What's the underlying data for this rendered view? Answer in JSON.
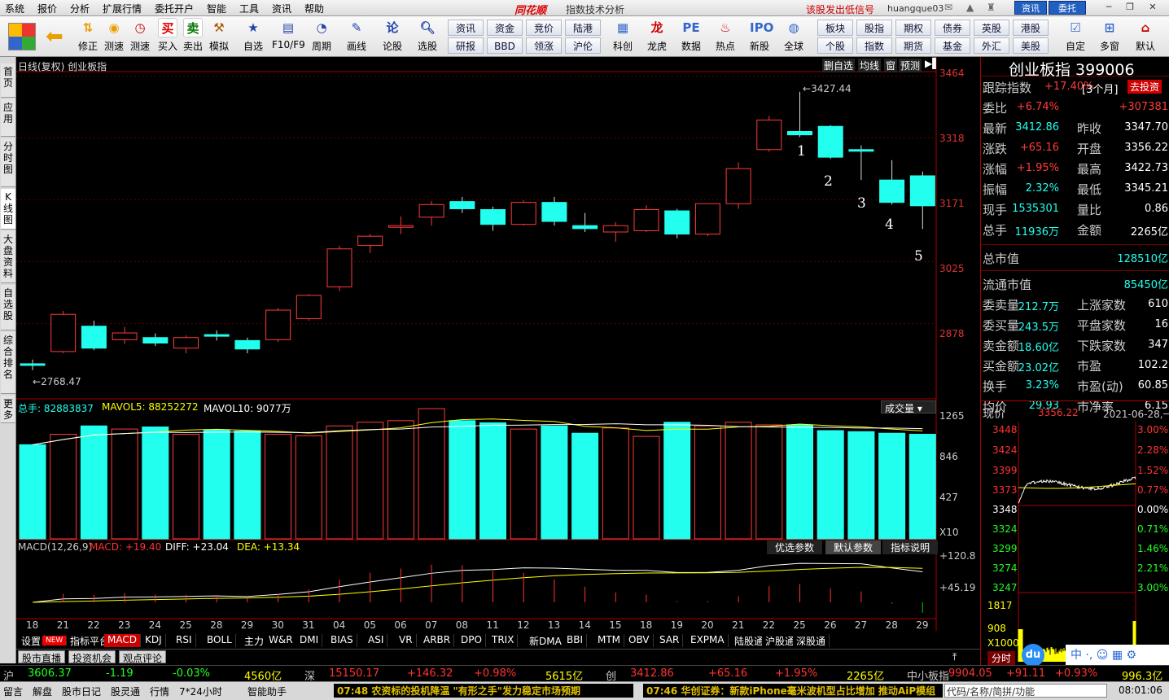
{
  "menu": {
    "items": [
      "系统",
      "报价",
      "分析",
      "扩展行情",
      "委托开户",
      "智能",
      "工具",
      "资讯",
      "帮助"
    ],
    "logo": "同花顺",
    "app_title": "指数技术分析",
    "signal": "该股发出低信号",
    "user": "huangque03",
    "btn_news": "资讯",
    "btn_trade": "委托"
  },
  "toolbar": {
    "buttons": [
      "修正",
      "测速",
      "买入",
      "卖出",
      "模拟",
      "自选",
      "F10/F9",
      "周期",
      "画线",
      "论股",
      "选股",
      "科创",
      "龙虎",
      "数据",
      "热点",
      "新股",
      "全球",
      "自定",
      "多窗",
      "默认"
    ],
    "grid": [
      [
        "资讯",
        "资金",
        "竞价",
        "陆港"
      ],
      [
        "研报",
        "BBD",
        "领涨",
        "沪伦"
      ],
      [
        "板块",
        "股指",
        "期权",
        "债券",
        "英股",
        "港股"
      ],
      [
        "个股",
        "指数",
        "期货",
        "基金",
        "外汇",
        "美股"
      ]
    ]
  },
  "lefttabs": [
    "首页",
    "应用",
    "分时图",
    "K线图",
    "大盘资料",
    "自选股",
    "综合排名",
    "更多"
  ],
  "chart": {
    "header_left": "日线(复权) 创业板指",
    "header_right": [
      "删自选",
      "均线",
      "窗",
      "预测"
    ],
    "price_ticks": [
      "3464",
      "3318",
      "3171",
      "3025",
      "2878"
    ],
    "high_label": "3427.44",
    "low_label": "2768.47",
    "markers": [
      "1",
      "2",
      "3",
      "4",
      "5"
    ],
    "vol_header": {
      "t1": "总手: 82883837",
      "t2": "MAVOL5: 88252272",
      "t3": "MAVOL10: 9077万"
    },
    "vol_select": "成交量",
    "vol_ticks": [
      "1265",
      "846",
      "427"
    ],
    "vol_unit": "X10",
    "macd_header": {
      "t1": "MACD(12,26,9)",
      "t2": "MACD: +19.40",
      "t3": "DIFF: +23.04",
      "t4": "DEA: +13.34"
    },
    "macd_btns": [
      "优选参数",
      "默认参数",
      "指标说明"
    ],
    "macd_ticks": [
      "+120.8",
      "+45.19"
    ],
    "x_labels": [
      "18",
      "21",
      "22",
      "23",
      "24",
      "25",
      "28",
      "29",
      "30",
      "31",
      "04",
      "05",
      "06",
      "07",
      "08",
      "11",
      "12",
      "13",
      "14",
      "15",
      "18",
      "19",
      "20",
      "21",
      "22",
      "25",
      "26",
      "27",
      "28",
      "29"
    ]
  },
  "chart_data": {
    "type": "candlestick",
    "candles": [
      [
        2783,
        2780,
        2793,
        2768
      ],
      [
        2812,
        2900,
        2908,
        2808
      ],
      [
        2872,
        2820,
        2885,
        2815
      ],
      [
        2840,
        2856,
        2870,
        2830
      ],
      [
        2845,
        2832,
        2855,
        2825
      ],
      [
        2820,
        2845,
        2850,
        2808
      ],
      [
        2852,
        2850,
        2862,
        2838
      ],
      [
        2838,
        2818,
        2845,
        2808
      ],
      [
        2840,
        2910,
        2915,
        2835
      ],
      [
        2890,
        2945,
        2948,
        2885
      ],
      [
        2965,
        3055,
        3062,
        2955
      ],
      [
        3063,
        3085,
        3090,
        3045
      ],
      [
        3108,
        3110,
        3132,
        3090
      ],
      [
        3130,
        3160,
        3168,
        3110
      ],
      [
        3167,
        3150,
        3178,
        3140
      ],
      [
        3148,
        3113,
        3155,
        3098
      ],
      [
        3113,
        3165,
        3170,
        3110
      ],
      [
        3165,
        3120,
        3178,
        3110
      ],
      [
        3110,
        3103,
        3140,
        3095
      ],
      [
        3095,
        3110,
        3118,
        3072
      ],
      [
        3098,
        3148,
        3158,
        3095
      ],
      [
        3145,
        3090,
        3150,
        3080
      ],
      [
        3090,
        3162,
        3162,
        3085
      ],
      [
        3162,
        3245,
        3260,
        3150
      ],
      [
        3290,
        3360,
        3370,
        3285
      ],
      [
        3333,
        3325,
        3427,
        3320
      ],
      [
        3345,
        3272,
        3348,
        3268
      ],
      [
        3290,
        3288,
        3300,
        3218
      ],
      [
        3218,
        3165,
        3265,
        3160
      ],
      [
        3228,
        3157,
        3238,
        3102
      ]
    ],
    "volumes": [
      900,
      1000,
      1080,
      1050,
      1070,
      1000,
      1040,
      1030,
      1000,
      985,
      1080,
      1115,
      1130,
      1245,
      1130,
      1110,
      1050,
      1080,
      1010,
      1060,
      980,
      1115,
      1080,
      1115,
      1090,
      1090,
      1035,
      1025,
      1010,
      1000
    ]
  },
  "rpanel": {
    "title": "创业板指  399006",
    "track": "跟踪指数",
    "track_val": "+17.40%",
    "track_period": "[3个月]",
    "invest_btn": "去投资",
    "rows": [
      [
        "委比",
        "+6.74%",
        "",
        "+307381"
      ],
      [
        "最新",
        "3412.86",
        "昨收",
        "3347.70"
      ],
      [
        "涨跌",
        "+65.16",
        "开盘",
        "3356.22"
      ],
      [
        "涨幅",
        "+1.95%",
        "最高",
        "3422.73"
      ],
      [
        "振幅",
        "2.32%",
        "最低",
        "3345.21"
      ],
      [
        "现手",
        "1535301",
        "量比",
        "0.86"
      ],
      [
        "总手",
        "11936万",
        "金额",
        "2265亿"
      ]
    ],
    "mktcap": [
      "总市值",
      "128510亿"
    ],
    "float": [
      "流通市值",
      "85450亿"
    ],
    "rows2": [
      [
        "委卖量",
        "212.7万",
        "上涨家数",
        "610"
      ],
      [
        "委买量",
        "243.5万",
        "平盘家数",
        "16"
      ],
      [
        "卖金额",
        "18.60亿",
        "下跌家数",
        "347"
      ],
      [
        "买金额",
        "23.02亿",
        "市盈",
        "102.2"
      ],
      [
        "换手",
        "3.23%",
        "市盈(动)",
        "60.85"
      ],
      [
        "均价",
        "29.93",
        "市净率",
        "6.15"
      ]
    ]
  },
  "mini": {
    "price_label": "现价",
    "price": "3356.22",
    "date": "2021-06-28,一",
    "left_ticks": [
      "3448",
      "3424",
      "3399",
      "3373",
      "3348",
      "3324",
      "3299",
      "3274",
      "3247"
    ],
    "right_ticks": [
      "3.00%",
      "2.28%",
      "1.52%",
      "0.77%",
      "0.00%",
      "0.71%",
      "1.46%",
      "2.21%",
      "3.00%"
    ],
    "vol_ticks": [
      "1817",
      "908",
      "X1000"
    ],
    "tab": "分时"
  },
  "indicators": [
    "设置",
    "NEW",
    "指标平台",
    "MACD",
    "KDJ",
    "RSI",
    "BOLL",
    "主力",
    "W&R",
    "DMI",
    "BIAS",
    "ASI",
    "VR",
    "ARBR",
    "DPO",
    "TRIX",
    "新DMA",
    "BBI",
    "MTM",
    "OBV",
    "SAR",
    "EXPMA",
    "陆股通",
    "沪股通",
    "深股通"
  ],
  "subtabs": [
    "股市直播",
    "投资机会",
    "观点评论"
  ],
  "indexbar": [
    [
      "沪",
      "3606.37",
      "-1.19",
      "-0.03%",
      "4560亿"
    ],
    [
      "深",
      "15150.17",
      "+146.32",
      "+0.98%",
      "5615亿"
    ],
    [
      "创",
      "3412.86",
      "+65.16",
      "+1.95%",
      "2265亿"
    ],
    [
      "中小板指",
      "9904.05",
      "+91.11",
      "+0.93%",
      "996.3亿"
    ]
  ],
  "status": {
    "items": [
      "留言",
      "解盘",
      "股市日记",
      "股灵通",
      "行情",
      "7*24小时",
      "智能助手"
    ],
    "ticker1": "07:48 农资标的投机降温 \"有形之手\"发力稳定市场预期",
    "ticker2": "07:46 华创证券：新款iPhone毫米波机型占比增加 推动AiP模组",
    "search": "代码/名称/简拼/功能",
    "clock": "08:01:06"
  }
}
